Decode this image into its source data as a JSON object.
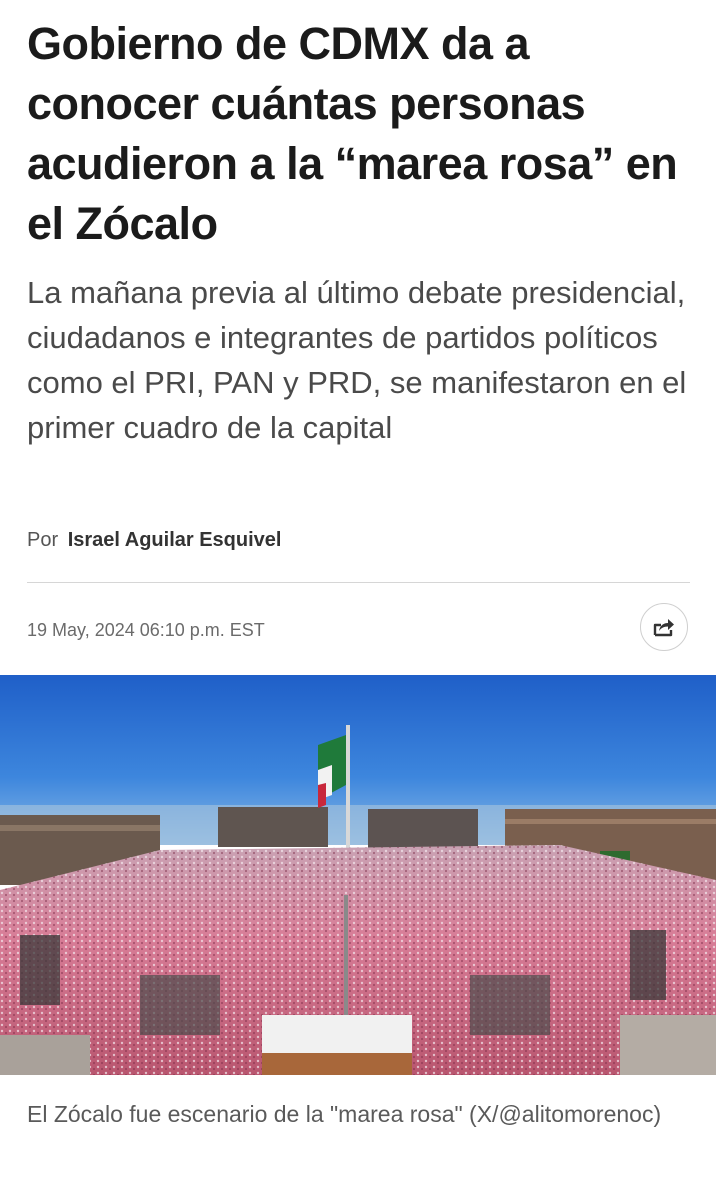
{
  "article": {
    "headline": "Gobierno de CDMX da a conocer cuántas personas acudieron a la “marea rosa” en el Zócalo",
    "subheadline": "La mañana previa al último debate presidencial, ciudadanos e integrantes de partidos políticos como el PRI, PAN y PRD, se manifestaron en el primer cuadro de la capital",
    "byline_prefix": "Por",
    "author": "Israel Aguilar Esquivel",
    "published": "19 May, 2024 06:10 p.m. EST",
    "share_icon": "share-icon",
    "image": {
      "description_icon": "zocalo-crowd-photo",
      "caption": "El Zócalo fue escenario de la \"marea rosa\" (X/@alitomorenoc)"
    }
  },
  "colors": {
    "headline": "#1b1b1b",
    "subheadline": "#4a4a4a",
    "sky": "#2f6fd0",
    "crowd_pink": "#d9738f",
    "divider": "#d6d6d6"
  }
}
